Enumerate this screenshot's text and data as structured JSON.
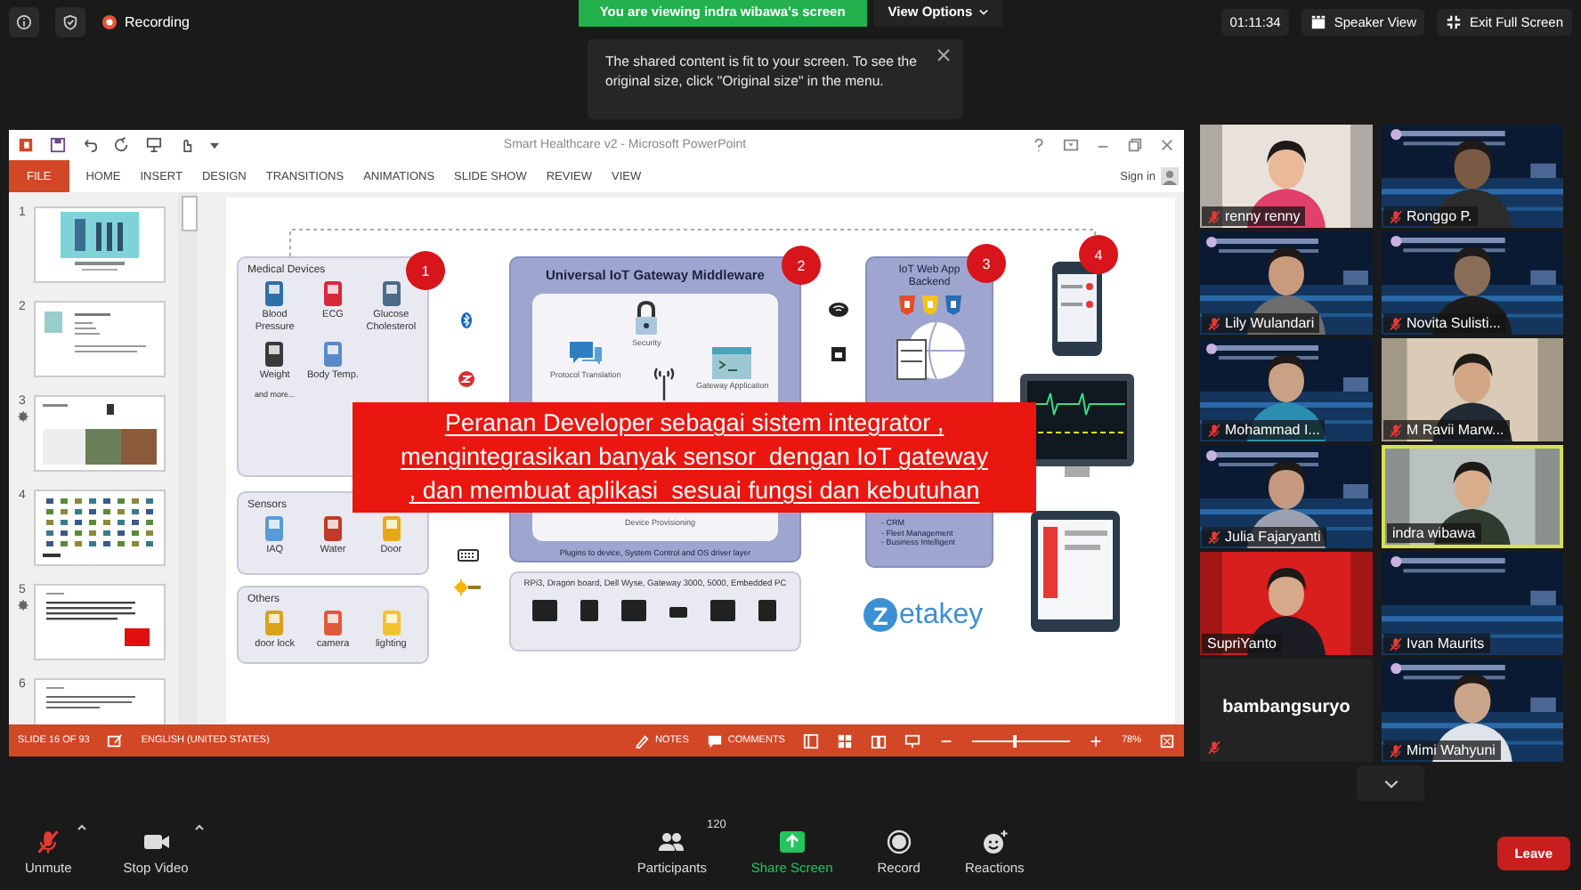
{
  "top_bar": {
    "recording": "Recording",
    "banner": "You are viewing indra wibawa's screen",
    "view_options": "View Options",
    "timer": "01:11:34",
    "speaker_view": "Speaker View",
    "exit_full_screen": "Exit Full Screen"
  },
  "notice": {
    "text": "The shared content is fit to your screen. To see the original size, click \"Original size\" in the menu."
  },
  "powerpoint": {
    "title": "Smart Healthcare v2 - Microsoft PowerPoint",
    "tabs": [
      {
        "label": "FILE",
        "selected": true
      },
      {
        "label": "HOME",
        "selected": false
      },
      {
        "label": "INSERT",
        "selected": false
      },
      {
        "label": "DESIGN",
        "selected": false
      },
      {
        "label": "TRANSITIONS",
        "selected": false
      },
      {
        "label": "ANIMATIONS",
        "selected": false
      },
      {
        "label": "SLIDE SHOW",
        "selected": false
      },
      {
        "label": "REVIEW",
        "selected": false
      },
      {
        "label": "VIEW",
        "selected": false
      }
    ],
    "sign_in": "Sign in",
    "slides": [
      {
        "number": "1",
        "animated": false
      },
      {
        "number": "2",
        "animated": false
      },
      {
        "number": "3",
        "animated": true
      },
      {
        "number": "4",
        "animated": false
      },
      {
        "number": "5",
        "animated": true
      },
      {
        "number": "6",
        "animated": false
      }
    ],
    "slide": {
      "medical": {
        "title": "Medical Devices",
        "items": [
          "Blood Pressure",
          "ECG",
          "Glucose Cholesterol",
          "Weight",
          "Body Temp."
        ],
        "more": "and more..."
      },
      "sensors": {
        "title": "Sensors",
        "items": [
          "IAQ",
          "Water",
          "Door"
        ]
      },
      "others": {
        "title": "Others",
        "items": [
          "door lock",
          "camera",
          "lighting"
        ]
      },
      "middleware": {
        "title": "Universal IoT Gateway Middleware",
        "security": "Security",
        "protocol": "Protocol Translation",
        "gateway": "Gateway Application",
        "provisioning": "Device Provisioning",
        "footer": "Plugins to device, System Control and OS driver layer"
      },
      "hardware": {
        "caption": "RPi3, Dragon board, Dell Wyse, Gateway 3000, 5000, Embedded PC"
      },
      "backend": {
        "title": "IoT Web App Backend",
        "features": [
          "- CRM",
          "- Fleet Management",
          "- Business Intelligent"
        ]
      },
      "logo": {
        "mark": "Z",
        "name": "etakey"
      },
      "steps": [
        "1",
        "2",
        "3",
        "4"
      ],
      "callout": "Peranan Developer sebagai sistem integrator ,\nmengintegrasikan banyak sensor  dengan IoT gateway\n, dan membuat aplikasi  sesuai fungsi dan kebutuhan"
    },
    "status_bar": {
      "slide_count": "SLIDE 16 OF 93",
      "language": "ENGLISH (UNITED STATES)",
      "notes": "NOTES",
      "comments": "COMMENTS",
      "zoom": {
        "level": 0.42
      },
      "zoom_reading": "78%"
    }
  },
  "participants": [
    {
      "name": "renny renny",
      "muted": true,
      "speaking": false,
      "camera_on": true
    },
    {
      "name": "Ronggo P.",
      "muted": true,
      "speaking": false,
      "camera_on": true
    },
    {
      "name": "Lily Wulandari",
      "muted": true,
      "speaking": false,
      "camera_on": true
    },
    {
      "name": "Novita Sulisti...",
      "muted": true,
      "speaking": false,
      "camera_on": true
    },
    {
      "name": "Mohammad I...",
      "muted": true,
      "speaking": false,
      "camera_on": true
    },
    {
      "name": "M Ravii Marw...",
      "muted": true,
      "speaking": false,
      "camera_on": true
    },
    {
      "name": "Julia Fajaryanti",
      "muted": true,
      "speaking": false,
      "camera_on": true
    },
    {
      "name": "indra wibawa",
      "muted": false,
      "speaking": true,
      "camera_on": true
    },
    {
      "name": "SupriYanto",
      "muted": false,
      "speaking": false,
      "camera_on": true
    },
    {
      "name": "Ivan Maurits",
      "muted": true,
      "speaking": false,
      "camera_on": true
    },
    {
      "name": "bambangsuryo",
      "muted": true,
      "speaking": false,
      "camera_on": false
    },
    {
      "name": "Mimi Wahyuni",
      "muted": true,
      "speaking": false,
      "camera_on": true
    }
  ],
  "toolbar": {
    "unmute": "Unmute",
    "stop_video": "Stop Video",
    "participants": "Participants",
    "participant_count": "120",
    "share_screen": "Share Screen",
    "record": "Record",
    "reactions": "Reactions",
    "leave": "Leave"
  }
}
